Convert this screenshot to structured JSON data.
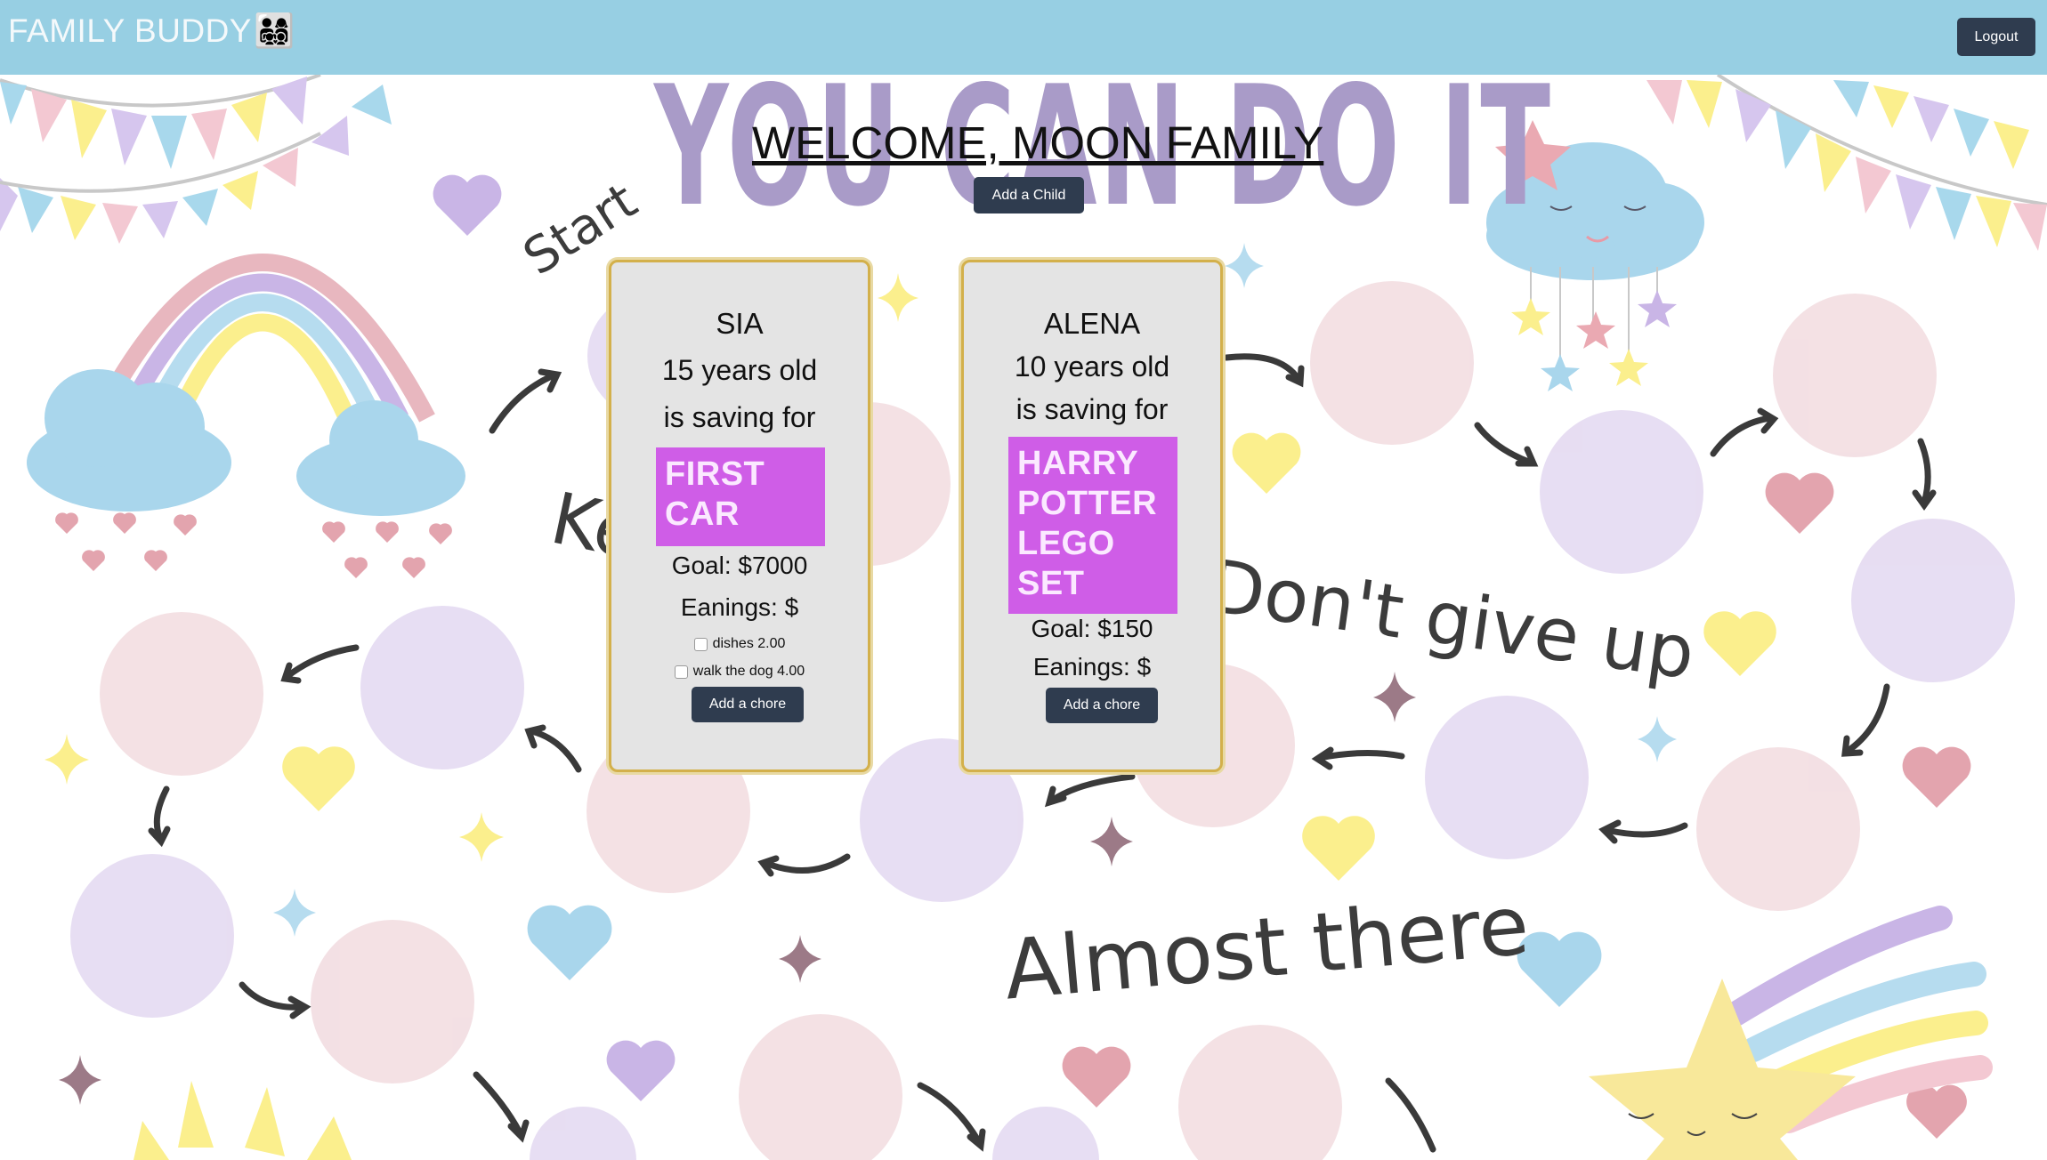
{
  "nav": {
    "brand": "FAMILY BUDDY",
    "brand_emoji": "👨‍👩‍👧‍👦",
    "logout_label": "Logout"
  },
  "background": {
    "motto": "YOU CAN DO IT",
    "start_label": "Start",
    "keep_label": "Ke",
    "dont_give_up_label": "Don't give up",
    "almost_there_label": "Almost there"
  },
  "header": {
    "welcome": "WELCOME, MOON FAMILY",
    "add_child_label": "Add a Child"
  },
  "children": [
    {
      "name": "SIA",
      "age": "15 years old",
      "saving_text": "is saving for",
      "goal_item": "FIRST CAR",
      "goal": "Goal: $7000",
      "earnings": "Eanings: $",
      "chores": [
        {
          "label": "dishes 2.00",
          "checked": false
        },
        {
          "label": "walk the dog 4.00",
          "checked": false
        }
      ],
      "add_chore_label": "Add a chore"
    },
    {
      "name": "ALENA",
      "age": "10 years old",
      "saving_text": "is saving for",
      "goal_item": "HARRY POTTER LEGO SET",
      "goal": "Goal: $150",
      "earnings": "Eanings: $",
      "chores": [],
      "add_chore_label": "Add a chore"
    }
  ],
  "colors": {
    "navbar": "#97cfe3",
    "button": "#2f3c4f",
    "card_bg": "#e4e4e4",
    "card_border": "#d3b04b",
    "goal_box": "#cf5de7",
    "motto": "#a99bc8",
    "circle_pink": "#f3dfe3",
    "circle_lavender": "#e6dcf2"
  }
}
